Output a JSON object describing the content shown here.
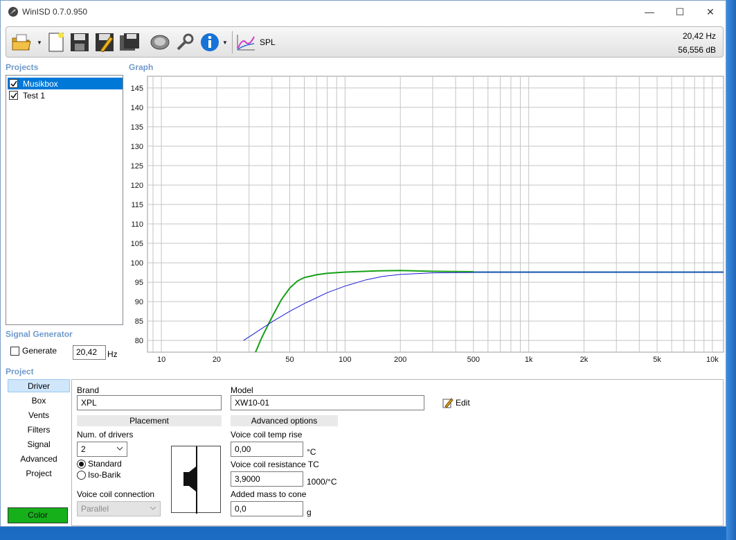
{
  "window": {
    "title": "WinISD 0.7.0.950"
  },
  "toolbar": {
    "spl_label": "SPL",
    "readout_freq": "20,42 Hz",
    "readout_db": "56,556 dB"
  },
  "sections": {
    "projects": "Projects",
    "graph": "Graph",
    "signal_generator": "Signal Generator",
    "project": "Project"
  },
  "projects": [
    {
      "label": "Musikbox",
      "checked": true,
      "selected": true
    },
    {
      "label": "Test 1",
      "checked": true,
      "selected": false
    }
  ],
  "signal_generator": {
    "generate_label": "Generate",
    "freq_value": "20,42",
    "unit": "Hz"
  },
  "nav": [
    "Driver",
    "Box",
    "Vents",
    "Filters",
    "Signal",
    "Advanced",
    "Project"
  ],
  "nav_selected": 0,
  "color_button": {
    "label": "Color",
    "color": "#16b01b"
  },
  "driver": {
    "brand_label": "Brand",
    "brand_value": "XPL",
    "model_label": "Model",
    "model_value": "XW10-01",
    "edit_label": "Edit",
    "placement_header": "Placement",
    "advanced_header": "Advanced options",
    "num_drivers_label": "Num. of drivers",
    "num_drivers_value": "2",
    "radio_standard": "Standard",
    "radio_isobarik": "Iso-Barik",
    "vc_connection_label": "Voice coil connection",
    "vc_connection_value": "Parallel",
    "vc_temp_label": "Voice coil temp rise",
    "vc_temp_value": "0,00",
    "vc_temp_unit": "°C",
    "vc_res_label": "Voice coil resistance TC",
    "vc_res_value": "3,9000",
    "vc_res_unit": "1000/°C",
    "added_mass_label": "Added mass to cone",
    "added_mass_value": "0,0",
    "added_mass_unit": "g"
  },
  "chart_data": {
    "type": "line",
    "title": "",
    "xlabel": "",
    "ylabel": "",
    "xscale": "log",
    "xlim": [
      8.4,
      11500
    ],
    "ylim": [
      77,
      148
    ],
    "x_ticks": [
      10,
      20,
      50,
      100,
      200,
      500,
      1000,
      2000,
      5000,
      10000
    ],
    "x_tick_labels": [
      "10",
      "20",
      "50",
      "100",
      "200",
      "500",
      "1k",
      "2k",
      "5k",
      "10k"
    ],
    "y_ticks": [
      80,
      85,
      90,
      95,
      100,
      105,
      110,
      115,
      120,
      125,
      130,
      135,
      140,
      145
    ],
    "grid": true,
    "series": [
      {
        "color": "#14a014",
        "x": [
          30,
          35,
          40,
          45,
          50,
          55,
          60,
          70,
          80,
          100,
          150,
          200,
          300,
          500
        ],
        "y": [
          73,
          80.5,
          86,
          90.5,
          93.5,
          95.3,
          96.2,
          96.9,
          97.3,
          97.6,
          97.9,
          98.0,
          97.8,
          97.7
        ]
      },
      {
        "color": "#1a1ad0",
        "x": [
          28,
          35,
          40,
          50,
          60,
          70,
          80,
          100,
          130,
          160,
          200,
          300,
          500,
          1000,
          11500
        ],
        "y": [
          80,
          83,
          84.8,
          87.5,
          89.5,
          91,
          92.3,
          94,
          95.6,
          96.5,
          97,
          97.4,
          97.5,
          97.5,
          97.5
        ]
      },
      {
        "color": "#1a60a8",
        "x": [
          500,
          1000,
          2000,
          5000,
          11500
        ],
        "y": [
          97.6,
          97.6,
          97.6,
          97.6,
          97.6
        ]
      }
    ]
  }
}
